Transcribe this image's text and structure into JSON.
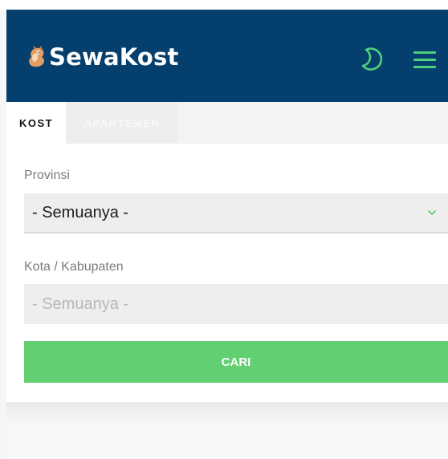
{
  "navbar": {
    "brand_name": "SewaKost",
    "logo_icon": "squirrel-logo-icon",
    "theme_toggle_icon": "moon-icon",
    "menu_icon": "hamburger-menu-icon",
    "background_color": "#043f6e",
    "icon_color": "#4ed07b"
  },
  "tabs": [
    {
      "label": "KOST",
      "active": true
    },
    {
      "label": "APARTEMEN",
      "active": false
    }
  ],
  "form": {
    "provinsi": {
      "label": "Provinsi",
      "selected": "- Semuanya -"
    },
    "kota": {
      "label": "Kota / Kabupaten",
      "selected": "- Semuanya -",
      "disabled": true
    },
    "submit_label": "CARI",
    "submit_color": "#61cf72",
    "chevron_icon": "chevron-down-icon"
  }
}
